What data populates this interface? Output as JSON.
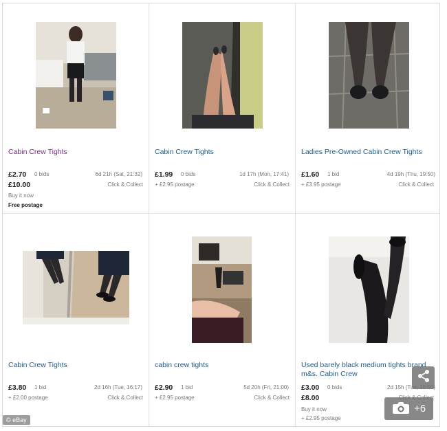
{
  "listings": [
    {
      "title": "Cabin Crew Tights",
      "price": "£2.70",
      "bids": "0 bids",
      "time": "6d 21h (Sat, 21:32)",
      "shipping": "Click & Collect",
      "bin_price": "£10.00",
      "bin_label": "Buy it now",
      "postage": "Free postage"
    },
    {
      "title": "Cabin Crew Tights",
      "price": "£1.99",
      "bids": "0 bids",
      "time": "1d 17h (Mon, 17:41)",
      "postage": "+ £2.95 postage",
      "shipping": "Click & Collect"
    },
    {
      "title": "Ladies Pre-Owned Cabin Crew Tights",
      "price": "£1.60",
      "bids": "1 bid",
      "time": "4d 19h (Thu, 19:50)",
      "postage": "+ £3.95 postage",
      "shipping": "Click & Collect"
    },
    {
      "title": "Cabin Crew Tights",
      "price": "£3.80",
      "bids": "1 bid",
      "time": "2d 16h (Tue, 16:17)",
      "postage": "+ £2.00 postage",
      "shipping": "Click & Collect"
    },
    {
      "title": "cabin crew tights",
      "price": "£2.90",
      "bids": "1 bid",
      "time": "5d 20h (Fri, 21:00)",
      "postage": "+ £2.95 postage",
      "shipping": "Click & Collect"
    },
    {
      "title": "Used barely black medium tights brand m&s. Cabin Crew",
      "price": "£3.00",
      "bids": "0 bids",
      "time": "2d 15h (Tue, 15:50)",
      "shipping": "Click & Collect",
      "bin_price": "£8.00",
      "bin_label": "Buy it now",
      "postage": "+ £2.95 postage"
    }
  ],
  "watermark": "© eBay",
  "photo_count": "+6",
  "icons": {
    "share": "share-icon",
    "camera": "camera-icon"
  }
}
